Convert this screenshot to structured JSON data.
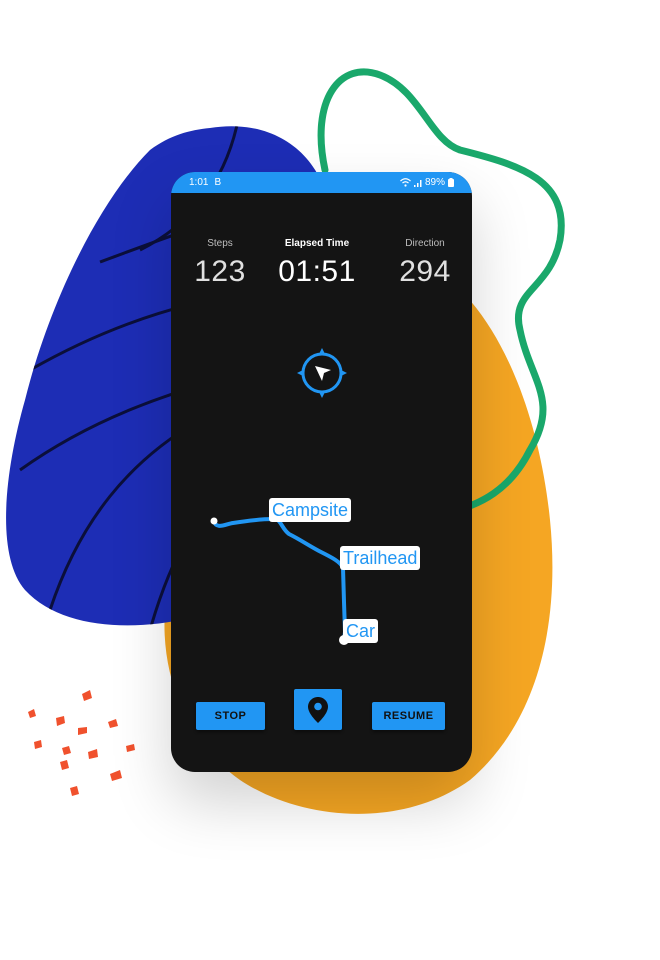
{
  "status_bar": {
    "time": "1:01",
    "notification_glyph": "B",
    "battery": "89%",
    "icons": [
      "wifi-icon",
      "signal-icon",
      "battery-icon"
    ]
  },
  "stats": {
    "steps": {
      "label": "Steps",
      "value": "123"
    },
    "elapsed": {
      "label": "Elapsed Time",
      "value": "01:51"
    },
    "direction": {
      "label": "Direction",
      "value": "294"
    }
  },
  "compass": {
    "icon": "compass-icon"
  },
  "map": {
    "places": [
      {
        "label": "Campsite"
      },
      {
        "label": "Trailhead"
      },
      {
        "label": "Car"
      }
    ]
  },
  "buttons": {
    "stop": "STOP",
    "marker_icon": "location-pin-icon",
    "resume": "RESUME"
  },
  "colors": {
    "accent": "#2196f3",
    "screen_bg": "#141414",
    "blob_blue": "#1d2db5",
    "blob_orange": "#f5a623",
    "squiggle_green": "#1aa86b",
    "dots_red": "#f0512d"
  }
}
